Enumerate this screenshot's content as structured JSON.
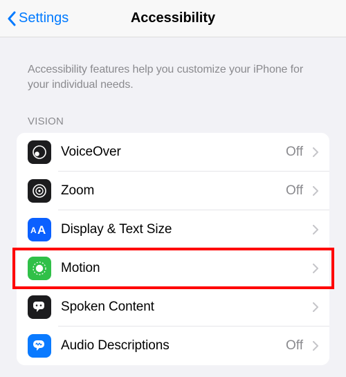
{
  "nav": {
    "back_label": "Settings",
    "title": "Accessibility"
  },
  "description": "Accessibility features help you customize your iPhone for your individual needs.",
  "section": {
    "header": "VISION",
    "items": [
      {
        "label": "VoiceOver",
        "value": "Off",
        "icon": "voiceover",
        "icon_bg": "#1c1c1e",
        "icon_fg": "#ffffff"
      },
      {
        "label": "Zoom",
        "value": "Off",
        "icon": "zoom",
        "icon_bg": "#1c1c1e",
        "icon_fg": "#ffffff"
      },
      {
        "label": "Display & Text Size",
        "value": "",
        "icon": "textsize",
        "icon_bg": "#0a60ff",
        "icon_fg": "#ffffff"
      },
      {
        "label": "Motion",
        "value": "",
        "icon": "motion",
        "icon_bg": "#30c048",
        "icon_fg": "#ffffff"
      },
      {
        "label": "Spoken Content",
        "value": "",
        "icon": "spoken",
        "icon_bg": "#1c1c1e",
        "icon_fg": "#ffffff"
      },
      {
        "label": "Audio Descriptions",
        "value": "Off",
        "icon": "audiodesc",
        "icon_bg": "#0a7aff",
        "icon_fg": "#ffffff"
      }
    ]
  }
}
